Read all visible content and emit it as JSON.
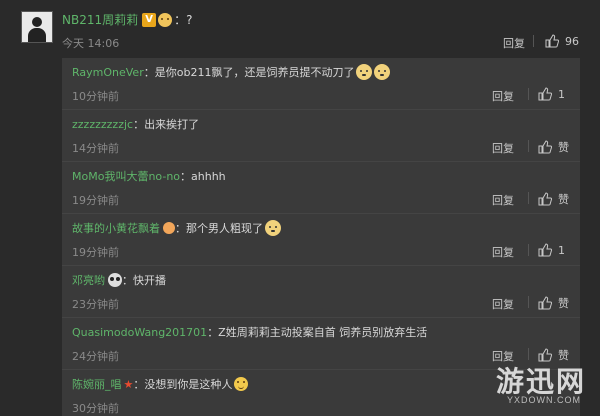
{
  "post": {
    "author": "NB211周莉莉",
    "badge": "V",
    "colon": "：?",
    "time": "今天 14:06",
    "reply_label": "回复",
    "like_count": "96",
    "icons": [
      "verified-badge",
      "emoji-face"
    ]
  },
  "comments": [
    {
      "name": "RaymOneVer",
      "text": "：是你ob211飘了，还是饲养员提不动刀了",
      "time": "10分钟前",
      "reply": "回复",
      "like": "1",
      "emojis": [
        "dog-emoji",
        "dog-emoji"
      ]
    },
    {
      "name": "zzzzzzzzzjc",
      "text": "：出来挨打了",
      "time": "14分钟前",
      "reply": "回复",
      "like": "赞",
      "emojis": []
    },
    {
      "name": "MoMo我叫大蕾no-no",
      "text": "：ahhhh",
      "time": "19分钟前",
      "reply": "回复",
      "like": "赞",
      "emojis": []
    },
    {
      "name": "故事的小黄花飘着",
      "text": "：那个男人粗现了",
      "time": "19分钟前",
      "reply": "回复",
      "like": "1",
      "emojis": [
        "fruit-emoji",
        "dog-emoji"
      ]
    },
    {
      "name": "邓亮哟",
      "text": "：快开播",
      "time": "23分钟前",
      "reply": "回复",
      "like": "赞",
      "emojis": [
        "panda-emoji"
      ]
    },
    {
      "name": "QuasimodoWang201701",
      "text": "：Z姓周莉莉主动投案自首  饲养员别放弃生活",
      "time": "24分钟前",
      "reply": "回复",
      "like": "赞",
      "emojis": []
    },
    {
      "name": "陈婉丽_唱",
      "text": "：没想到你是这种人",
      "time": "30分钟前",
      "reply": "回复",
      "like": "",
      "emojis": [
        "star-icon",
        "smile-emoji"
      ]
    }
  ],
  "watermark": {
    "main": "游迅网",
    "sub": "YXDOWN.COM"
  },
  "colors": {
    "name": "#5fb56a",
    "background": "#2a2a2a",
    "thread_bg": "#3a3a3a"
  }
}
